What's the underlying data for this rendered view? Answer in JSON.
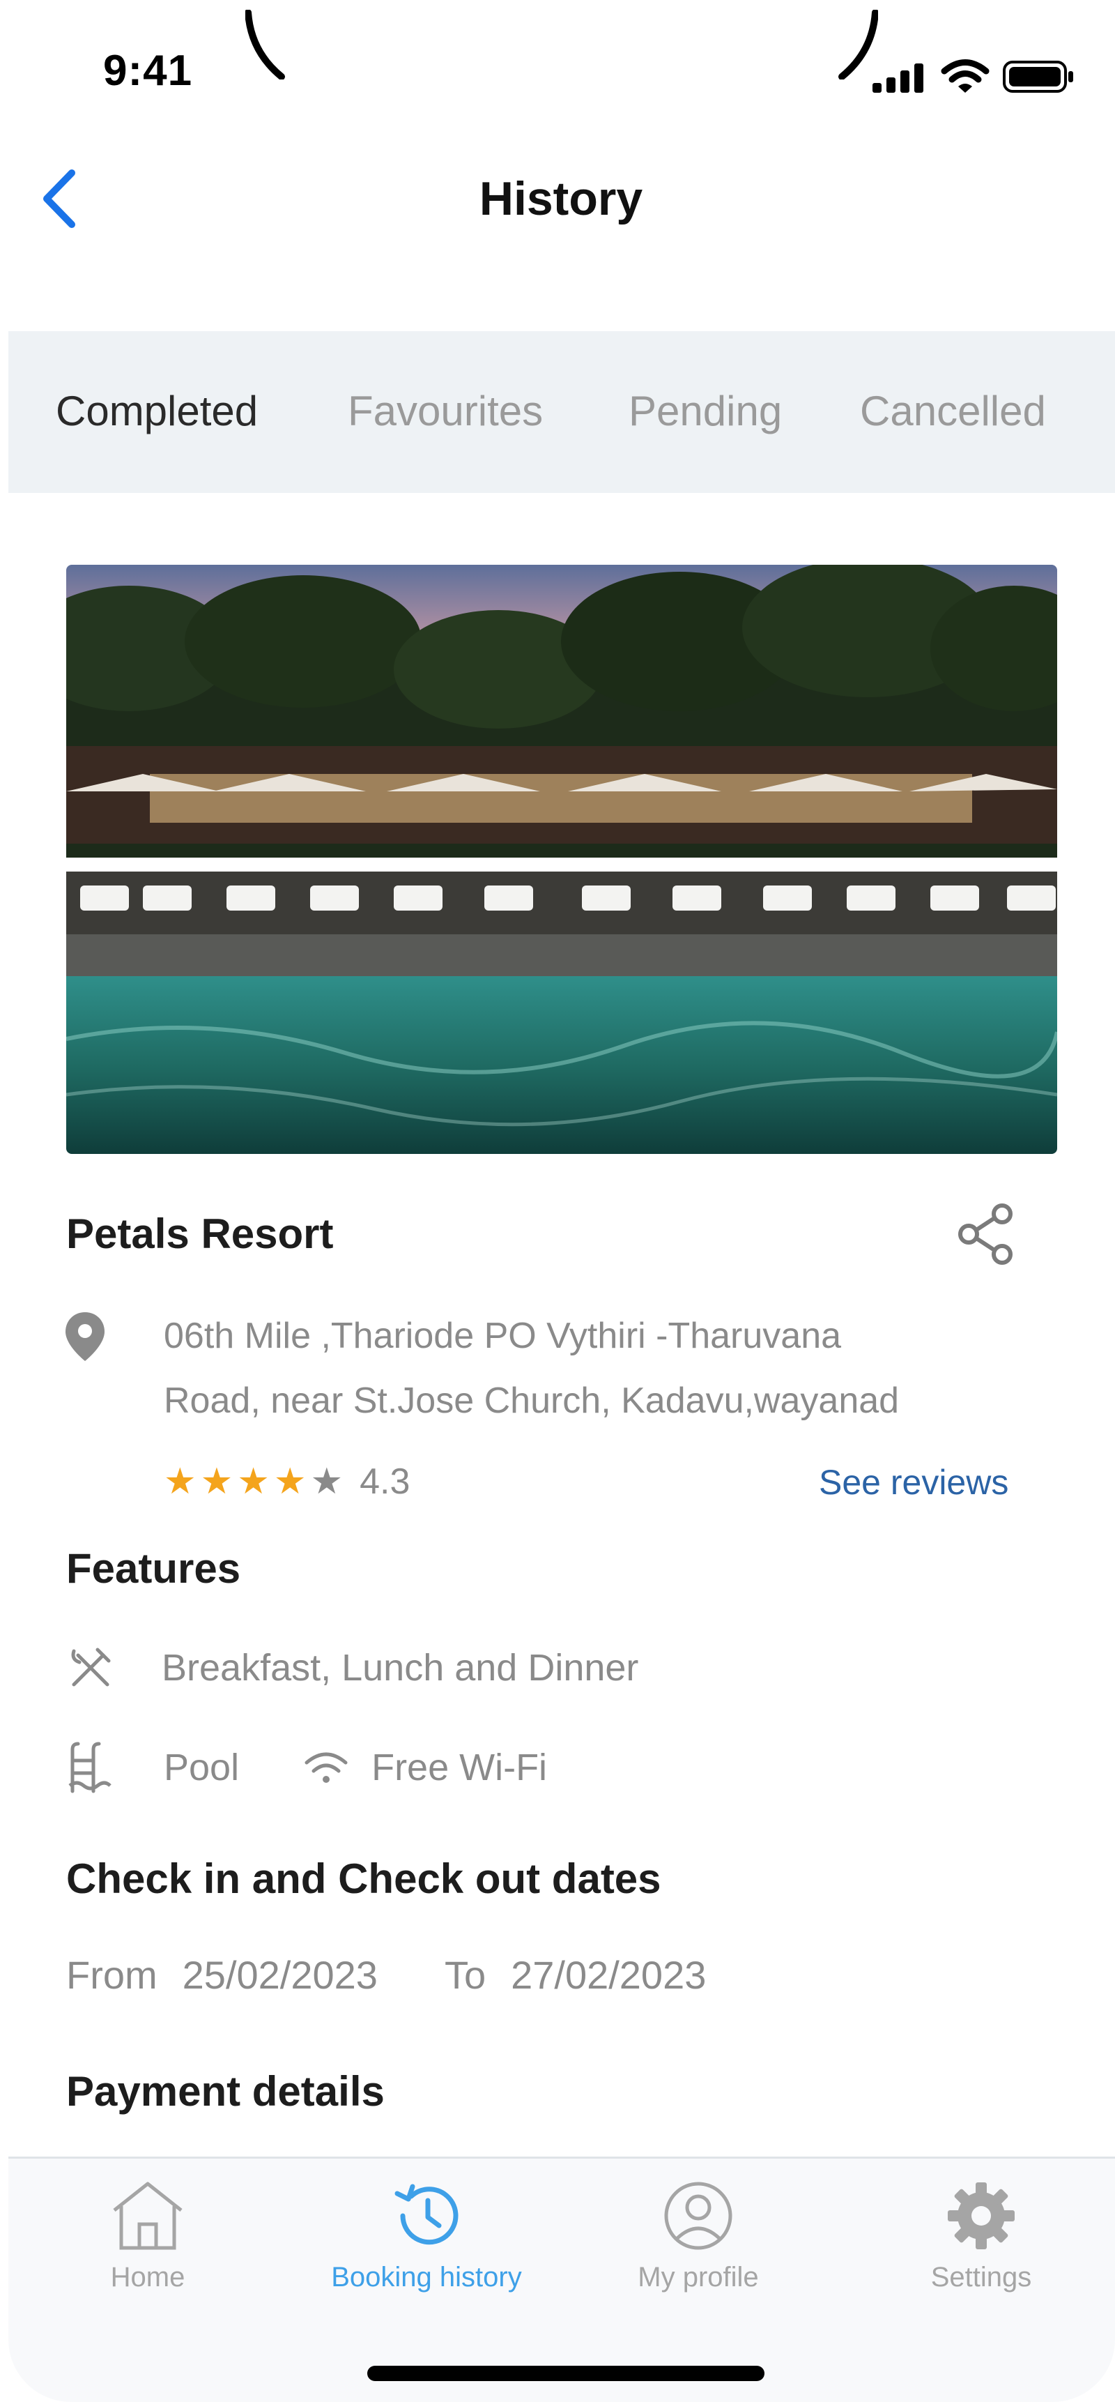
{
  "status_bar": {
    "time": "9:41"
  },
  "header": {
    "back_icon": "chevron-left-icon",
    "title": "History"
  },
  "tabs": [
    {
      "label": "Completed",
      "active": true
    },
    {
      "label": "Favourites",
      "active": false
    },
    {
      "label": "Pending",
      "active": false
    },
    {
      "label": "Cancelled",
      "active": false
    }
  ],
  "resort": {
    "image": "resort-pool-photo",
    "name": "Petals Resort",
    "address_line1": "06th Mile ,Thariode PO Vythiri -Tharuvana",
    "address_line2": "Road,  near St.Jose Church, Kadavu,wayanad",
    "rating_value": "4.3",
    "rating_stars": 4,
    "see_reviews": "See reviews"
  },
  "features": {
    "title": "Features",
    "meals": "Breakfast, Lunch and Dinner",
    "pool": "Pool",
    "wifi": "Free Wi-Fi"
  },
  "dates": {
    "title": "Check in and Check out dates",
    "from_label": "From",
    "from_value": "25/02/2023",
    "to_label": "To",
    "to_value": "27/02/2023"
  },
  "payment": {
    "title": "Payment details"
  },
  "bottom_nav": [
    {
      "label": "Home",
      "icon": "home-icon",
      "active": false
    },
    {
      "label": "Booking history",
      "icon": "history-icon",
      "active": true
    },
    {
      "label": "My profile",
      "icon": "user-icon",
      "active": false
    },
    {
      "label": "Settings",
      "icon": "gear-icon",
      "active": false
    }
  ],
  "colors": {
    "accent": "#3ea0e8",
    "link": "#2b63a6",
    "star": "#f4a41c",
    "tab_bg": "#eef2f5"
  }
}
